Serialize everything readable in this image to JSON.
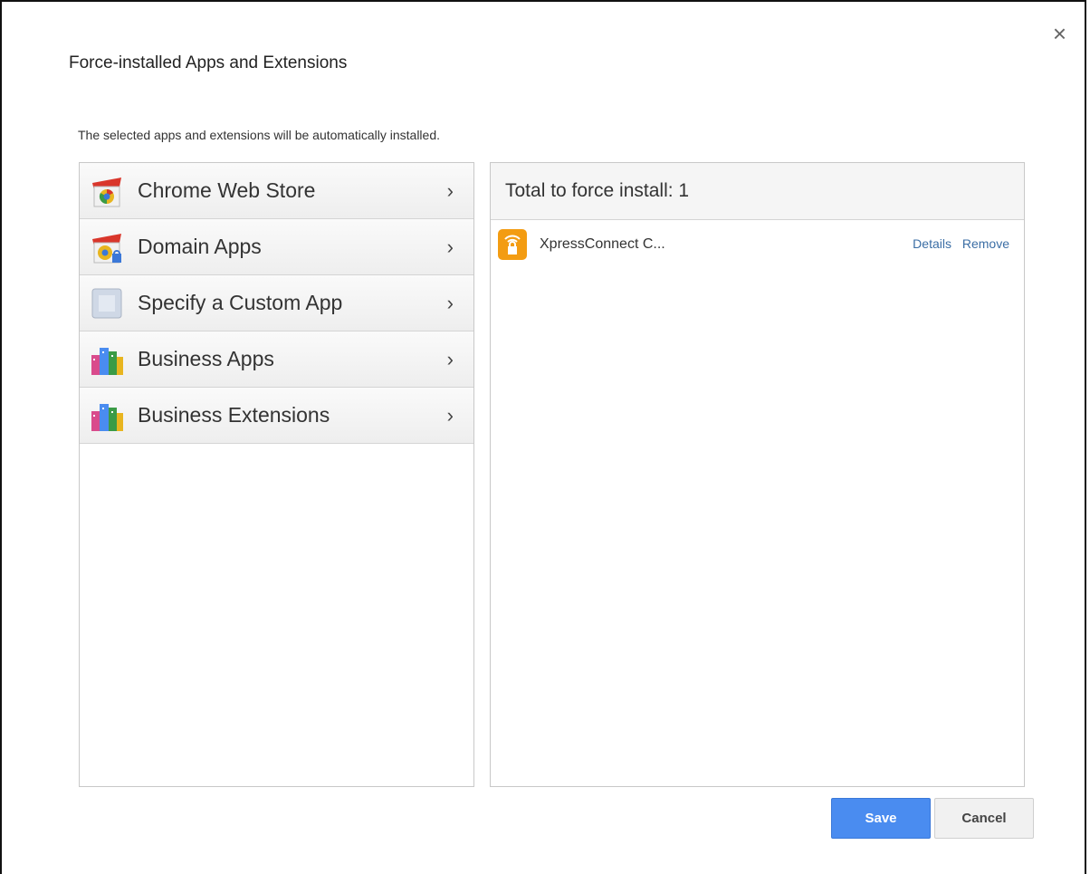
{
  "dialog": {
    "title": "Force-installed Apps and Extensions",
    "subtitle": "The selected apps and extensions will be automatically installed.",
    "close_glyph": "×"
  },
  "sources": {
    "items": [
      {
        "label": "Chrome Web Store",
        "icon": "chrome-web-store-icon"
      },
      {
        "label": "Domain Apps",
        "icon": "domain-apps-icon"
      },
      {
        "label": "Specify a Custom App",
        "icon": "custom-app-icon"
      },
      {
        "label": "Business Apps",
        "icon": "business-apps-icon"
      },
      {
        "label": "Business Extensions",
        "icon": "business-extensions-icon"
      }
    ],
    "chevron": "›"
  },
  "selected": {
    "header": "Total to force install: 1",
    "apps": [
      {
        "name": "XpressConnect C...",
        "icon": "wifi-lock-icon",
        "details_label": "Details",
        "remove_label": "Remove"
      }
    ]
  },
  "buttons": {
    "save_label": "Save",
    "cancel_label": "Cancel"
  },
  "colors": {
    "primary": "#4a8cf0",
    "link": "#3b6ea5",
    "app_icon": "#f39c12"
  }
}
